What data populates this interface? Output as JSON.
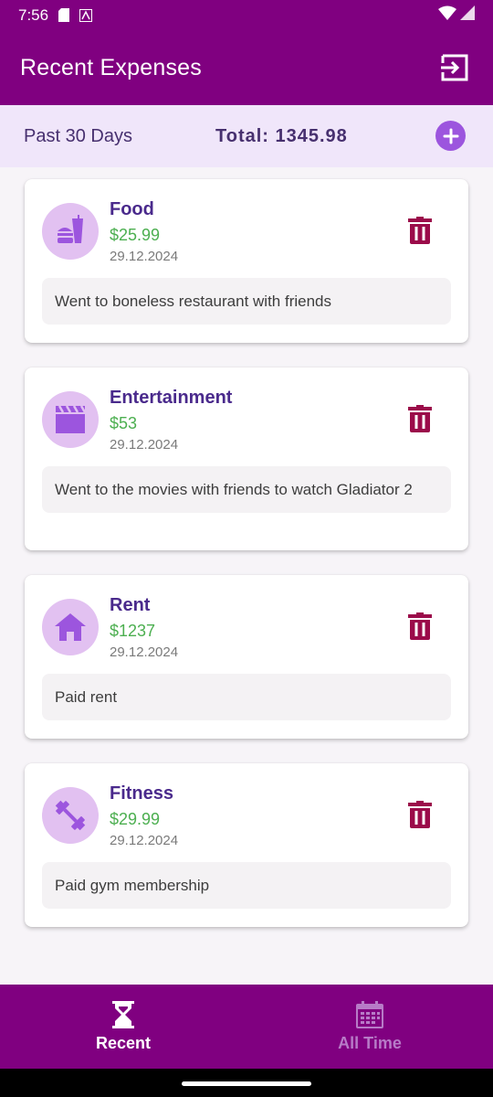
{
  "status_bar": {
    "time": "7:56"
  },
  "header": {
    "title": "Recent Expenses",
    "logout_icon": "logout-icon"
  },
  "summary": {
    "period": "Past 30 Days",
    "total": "Total: 1345.98",
    "add_icon": "plus-icon"
  },
  "expenses": [
    {
      "category": "Food",
      "icon": "fastfood-icon",
      "amount": "$25.99",
      "date": "29.12.2024",
      "note": "Went to boneless restaurant with friends"
    },
    {
      "category": "Entertainment",
      "icon": "movie-icon",
      "amount": "$53",
      "date": "29.12.2024",
      "note": "Went to the movies with friends to watch Gladiator 2"
    },
    {
      "category": "Rent",
      "icon": "home-icon",
      "amount": "$1237",
      "date": "29.12.2024",
      "note": "Paid rent"
    },
    {
      "category": "Fitness",
      "icon": "dumbbell-icon",
      "amount": "$29.99",
      "date": "29.12.2024",
      "note": "Paid gym membership"
    }
  ],
  "bottom_nav": {
    "recent": {
      "label": "Recent",
      "icon": "hourglass-icon",
      "active": true
    },
    "all_time": {
      "label": "All Time",
      "icon": "calendar-icon",
      "active": false
    }
  },
  "colors": {
    "primary": "#800080",
    "summary_bg": "#f0e6fa",
    "accent": "#9c55de",
    "amount": "#4caf50",
    "delete": "#9b0b4a"
  }
}
